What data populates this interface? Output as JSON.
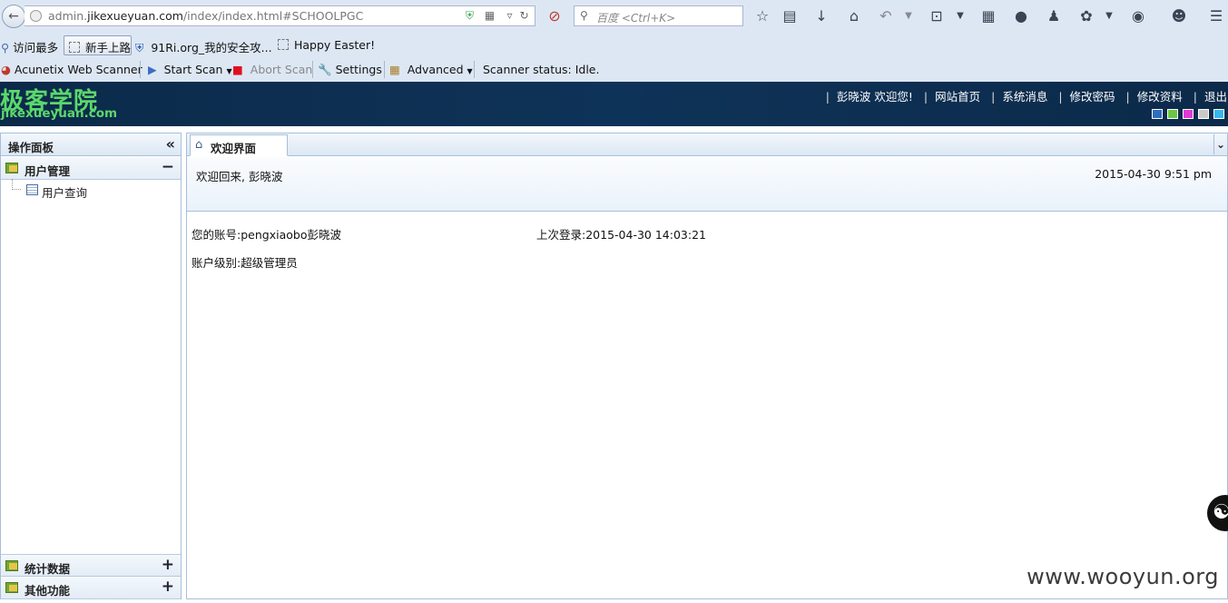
{
  "browser": {
    "url_prefix": "admin.",
    "url_domain": "jikexueyuan.com",
    "url_path": "/index/index.html#SCHOOLPGC",
    "search_placeholder": "百度 <Ctrl+K>"
  },
  "bookmarks": [
    {
      "label": "访问最多"
    },
    {
      "label": "新手上路"
    },
    {
      "label": "91Ri.org_我的安全攻..."
    },
    {
      "label": "Happy Easter!"
    }
  ],
  "scanner": {
    "brand": "Acunetix Web Scanner",
    "start_scan": "Start Scan",
    "abort_scan": "Abort Scan",
    "settings": "Settings",
    "advanced": "Advanced",
    "status": "Scanner status: Idle."
  },
  "app": {
    "logo_cn": "极客学院",
    "logo_en": "jikexueyuan.com",
    "nav": {
      "welcome": "彭晓波 欢迎您!",
      "home": "网站首页",
      "messages": "系统消息",
      "change_password": "修改密码",
      "edit_profile": "修改资料",
      "logout": "退出"
    },
    "theme_colors": [
      "#2e6ebd",
      "#6cc644",
      "#e23ad6",
      "#c8c8c8",
      "#38b6ee"
    ]
  },
  "sidebar": {
    "title": "操作面板",
    "sections": [
      {
        "label": "用户管理",
        "toggle": "−",
        "items": [
          {
            "label": "用户查询"
          }
        ]
      },
      {
        "label": "统计数据",
        "toggle": "+"
      },
      {
        "label": "其他功能",
        "toggle": "+"
      }
    ]
  },
  "main": {
    "tab_label": "欢迎界面",
    "welcome_message": "欢迎回来, 彭晓波",
    "welcome_time": "2015-04-30 9:51 pm",
    "account_label": "您的账号:",
    "account_value": "pengxiaobo彭晓波",
    "last_login_label": "上次登录:",
    "last_login_value": "2015-04-30 14:03:21",
    "level_label": "账户级别:",
    "level_value": "超级管理员"
  },
  "watermark": "www.wooyun.org"
}
